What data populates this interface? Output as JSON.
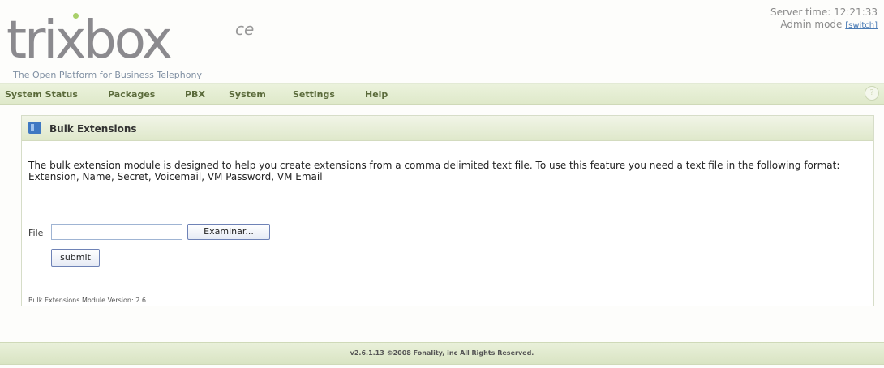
{
  "header": {
    "logo_text": "trixbox",
    "logo_edition": "ce",
    "tagline": "The Open Platform for Business Telephony",
    "server_time": "Server time: 12:21:33",
    "admin_mode": "Admin mode",
    "switch_link": "[switch]"
  },
  "nav": {
    "items": [
      {
        "label": "System Status"
      },
      {
        "label": "Packages"
      },
      {
        "label": "PBX"
      },
      {
        "label": "System"
      },
      {
        "label": "Settings"
      },
      {
        "label": "Help"
      }
    ],
    "help_icon": "?"
  },
  "panel": {
    "title": "Bulk Extensions",
    "icon": "module-icon",
    "description": "The bulk extension module is designed to help you create extensions from a comma delimited text file. To use this feature you need a text file in the following format:",
    "format": "Extension, Name, Secret, Voicemail, VM Password, VM Email",
    "file_label": "File",
    "file_value": "",
    "browse_label": "Examinar...",
    "submit_label": "submit",
    "version": "Bulk Extensions Module Version: 2.6"
  },
  "footer": {
    "text": "v2.6.1.13 ©2008 Fonality, inc All Rights Reserved."
  },
  "colors": {
    "logo_gray": "#8b8a8e",
    "logo_green": "#a9d06a",
    "nav_text": "#5a6a3a",
    "link": "#4a7bb5"
  }
}
